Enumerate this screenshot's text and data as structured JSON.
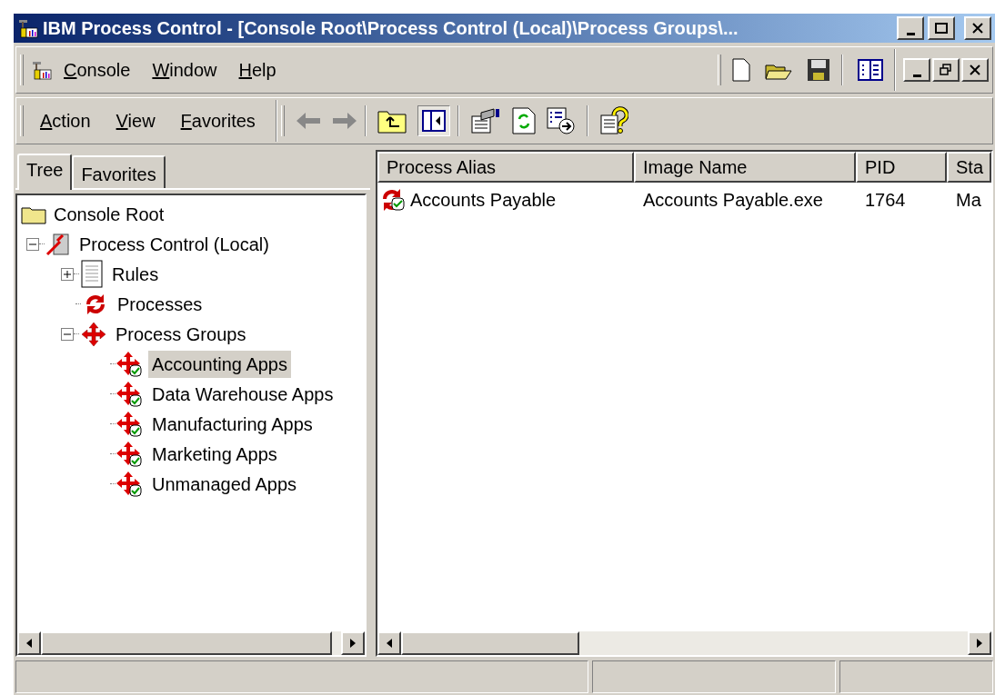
{
  "window": {
    "title": "IBM Process Control - [Console Root\\Process Control (Local)\\Process Groups\\..."
  },
  "menu": [
    "Console",
    "Window",
    "Help"
  ],
  "action_menu": [
    "Action",
    "View",
    "Favorites"
  ],
  "scope_tabs": [
    {
      "label": "Tree",
      "selected": true
    },
    {
      "label": "Favorites",
      "selected": false
    }
  ],
  "tree": [
    {
      "label": "Console Root",
      "kind": "folder",
      "selected": false,
      "children": [
        {
          "label": "Process Control (Local)",
          "kind": "server",
          "selected": false,
          "expanded": true,
          "children": [
            {
              "label": "Rules",
              "kind": "document",
              "selected": false,
              "expanded": false
            },
            {
              "label": "Processes",
              "kind": "processes",
              "selected": false
            },
            {
              "label": "Process Groups",
              "kind": "groups",
              "selected": false,
              "expanded": true,
              "children": [
                {
                  "label": "Accounting Apps",
                  "kind": "group",
                  "selected": true
                },
                {
                  "label": "Data Warehouse Apps",
                  "kind": "group",
                  "selected": false
                },
                {
                  "label": "Manufacturing Apps",
                  "kind": "group",
                  "selected": false
                },
                {
                  "label": "Marketing Apps",
                  "kind": "group",
                  "selected": false
                },
                {
                  "label": "Unmanaged Apps",
                  "kind": "group",
                  "selected": false
                }
              ]
            }
          ]
        }
      ]
    }
  ],
  "table": {
    "columns": [
      "Process Alias",
      "Image Name",
      "PID",
      "Sta"
    ],
    "rows": [
      [
        "Accounts Payable",
        "Accounts Payable.exe",
        "1764",
        "Ma"
      ]
    ]
  }
}
